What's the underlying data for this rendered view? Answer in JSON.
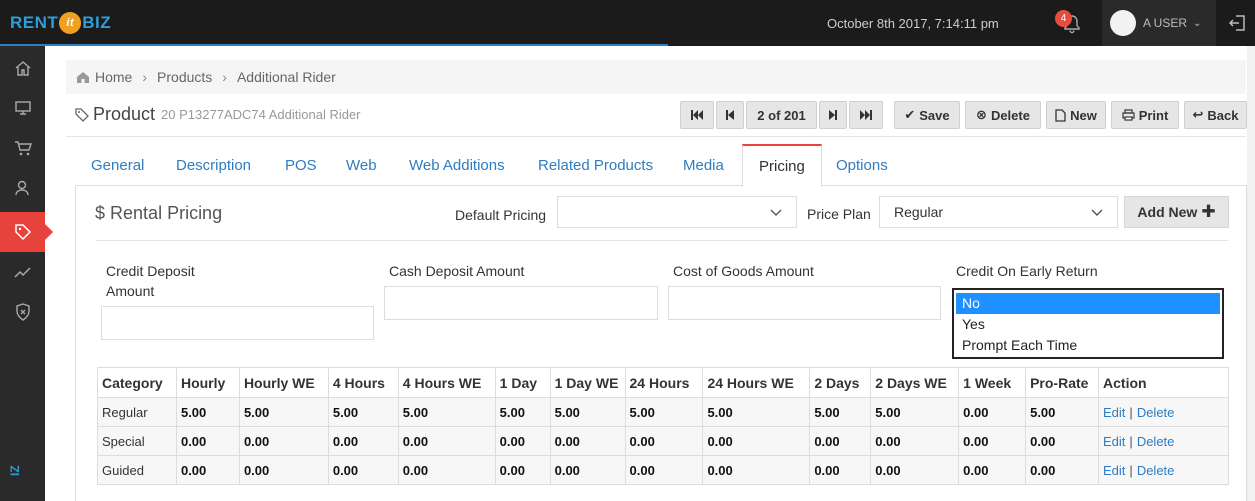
{
  "header": {
    "logo": {
      "rent": "RENT",
      "it": "it",
      "biz": "BIZ"
    },
    "datetime": "October 8th 2017, 7:14:11 pm",
    "notification_count": "4",
    "user_name": "A USER"
  },
  "sidebar": {
    "items": [
      "home-icon",
      "monitor-icon",
      "cart-icon",
      "users-icon",
      "tag-icon",
      "chart-icon",
      "shield-icon"
    ],
    "active": "tag-icon",
    "bottom_text": "IZ"
  },
  "breadcrumb": [
    "Home",
    "Products",
    "Additional Rider"
  ],
  "product": {
    "label": "Product",
    "subtitle": "20 P13277ADC74 Additional Rider"
  },
  "toolbar": {
    "record_position": "2 of 201",
    "save": "Save",
    "delete": "Delete",
    "new": "New",
    "print": "Print",
    "back": "Back"
  },
  "tabs": [
    "General",
    "Description",
    "POS",
    "Web",
    "Web Additions",
    "Related Products",
    "Media",
    "Pricing",
    "Options"
  ],
  "active_tab": "Pricing",
  "pricing": {
    "section_title": "Rental Pricing",
    "default_pricing_label": "Default Pricing",
    "default_pricing_value": "",
    "price_plan_label": "Price Plan",
    "price_plan_value": "Regular",
    "add_new": "Add New",
    "credit_deposit_label_1": "Credit Deposit",
    "credit_deposit_label_2": "Amount",
    "cash_deposit_label": "Cash Deposit Amount",
    "cogs_label": "Cost of Goods Amount",
    "credit_early_return_label": "Credit On Early Return",
    "credit_early_return_options": [
      "No",
      "Yes",
      "Prompt Each Time"
    ],
    "credit_early_return_selected": "No"
  },
  "table": {
    "columns": [
      "Category",
      "Hourly",
      "Hourly WE",
      "4 Hours",
      "4 Hours WE",
      "1 Day",
      "1 Day WE",
      "24 Hours",
      "24 Hours WE",
      "2 Days",
      "2 Days WE",
      "1 Week",
      "Pro-Rate",
      "Action"
    ],
    "rows": [
      {
        "category": "Regular",
        "values": [
          "5.00",
          "5.00",
          "5.00",
          "5.00",
          "5.00",
          "5.00",
          "5.00",
          "5.00",
          "5.00",
          "5.00",
          "0.00",
          "5.00"
        ]
      },
      {
        "category": "Special",
        "values": [
          "0.00",
          "0.00",
          "0.00",
          "0.00",
          "0.00",
          "0.00",
          "0.00",
          "0.00",
          "0.00",
          "0.00",
          "0.00",
          "0.00"
        ]
      },
      {
        "category": "Guided",
        "values": [
          "0.00",
          "0.00",
          "0.00",
          "0.00",
          "0.00",
          "0.00",
          "0.00",
          "0.00",
          "0.00",
          "0.00",
          "0.00",
          "0.00"
        ]
      }
    ],
    "edit_label": "Edit",
    "delete_label": "Delete",
    "separator": "|"
  },
  "colors": {
    "accent": "#e8423c",
    "link": "#2e7cc1",
    "topbar": "#1b1b1b",
    "sidebar": "#2a2a2a",
    "selected": "#1e90ff"
  }
}
